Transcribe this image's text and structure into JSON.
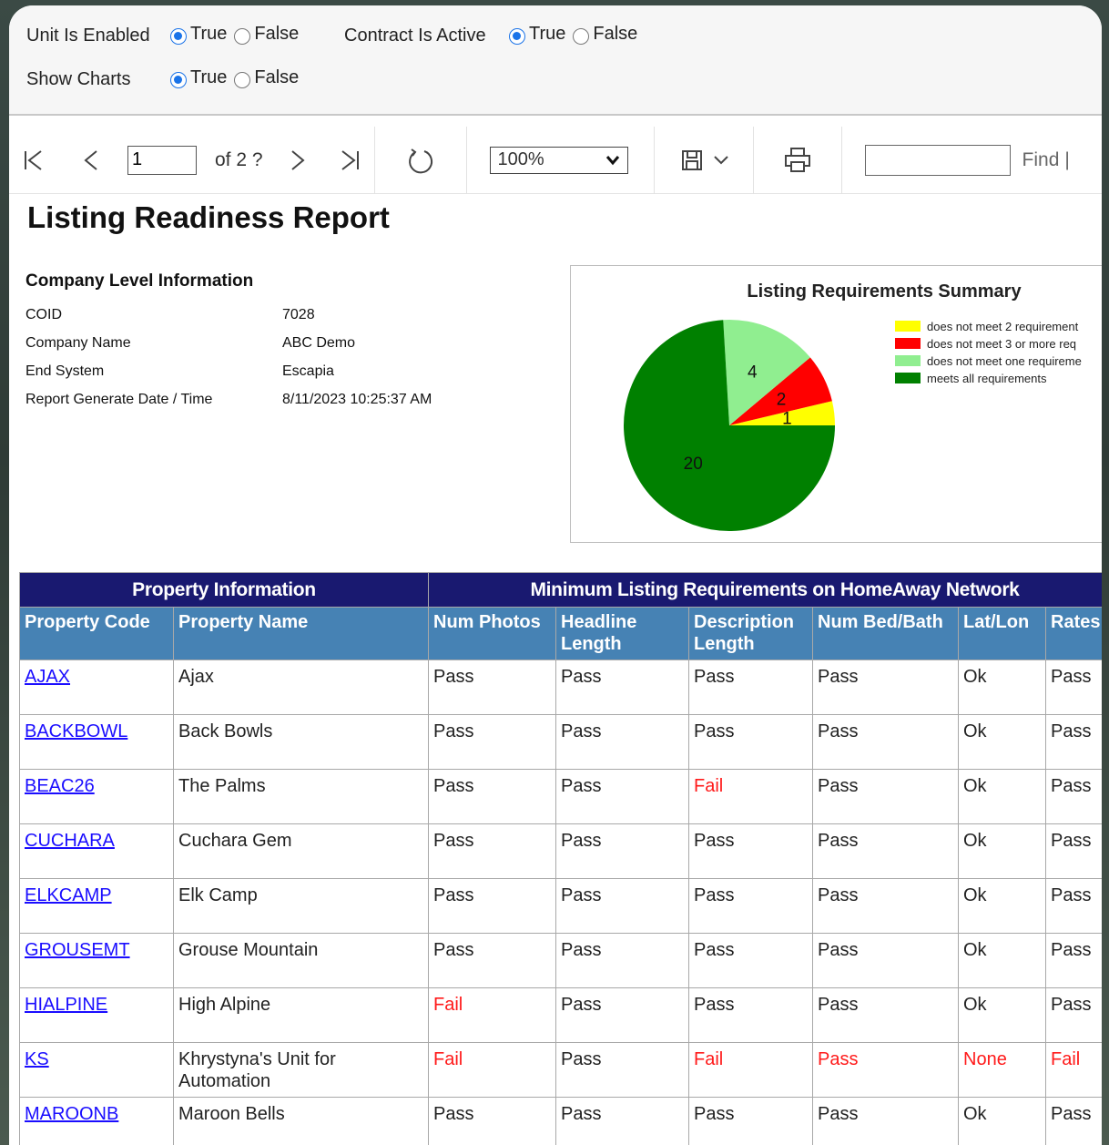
{
  "params": {
    "unit_enabled_label": "Unit Is Enabled",
    "contract_active_label": "Contract Is Active",
    "show_charts_label": "Show Charts",
    "true_label": "True",
    "false_label": "False"
  },
  "toolbar": {
    "page_value": "1",
    "page_of": "of 2 ?",
    "zoom_value": "100%",
    "find_label": "Find",
    "find_sep": "|"
  },
  "report": {
    "title": "Listing Readiness Report",
    "company_heading": "Company Level Information",
    "info": [
      {
        "key": "COID",
        "value": "7028"
      },
      {
        "key": "Company Name",
        "value": "ABC Demo"
      },
      {
        "key": "End System",
        "value": "Escapia"
      },
      {
        "key": "Report Generate Date / Time",
        "value": "8/11/2023 10:25:37 AM"
      }
    ]
  },
  "chart_data": {
    "type": "pie",
    "title": "Listing Requirements Summary",
    "slices": [
      {
        "label": "does not meet 2 requirement",
        "value": 1,
        "color": "#ffff00"
      },
      {
        "label": "does not meet 3 or more req",
        "value": 2,
        "color": "#ff0000"
      },
      {
        "label": "does not meet one requireme",
        "value": 4,
        "color": "#90ee90"
      },
      {
        "label": "meets all requirements",
        "value": 20,
        "color": "#008000"
      }
    ]
  },
  "table": {
    "group_property": "Property Information",
    "group_min": "Minimum Listing Requirements on HomeAway Network",
    "headers": [
      "Property Code",
      "Property Name",
      "Num Photos",
      "Headline Length",
      "Description Length",
      "Num Bed/Bath",
      "Lat/Lon",
      "Rates"
    ],
    "rows": [
      [
        "AJAX",
        "Ajax",
        "Pass",
        "Pass",
        "Pass",
        "Pass",
        "Ok",
        "Pass"
      ],
      [
        "BACKBOWL",
        "Back Bowls",
        "Pass",
        "Pass",
        "Pass",
        "Pass",
        "Ok",
        "Pass"
      ],
      [
        "BEAC26",
        "The Palms",
        "Pass",
        "Pass",
        "Fail",
        "Pass",
        "Ok",
        "Pass"
      ],
      [
        "CUCHARA",
        "Cuchara Gem",
        "Pass",
        "Pass",
        "Pass",
        "Pass",
        "Ok",
        "Pass"
      ],
      [
        "ELKCAMP",
        "Elk Camp",
        "Pass",
        "Pass",
        "Pass",
        "Pass",
        "Ok",
        "Pass"
      ],
      [
        "GROUSEMT",
        "Grouse Mountain",
        "Pass",
        "Pass",
        "Pass",
        "Pass",
        "Ok",
        "Pass"
      ],
      [
        "HIALPINE",
        "High Alpine",
        "Fail",
        "Pass",
        "Pass",
        "Pass",
        "Ok",
        "Pass"
      ],
      [
        "KS",
        "Khrystyna's Unit for Automation",
        "Fail",
        "Pass",
        "Fail",
        "Pass",
        "None",
        "Fail"
      ],
      [
        "MAROONB",
        "Maroon Bells",
        "Pass",
        "Pass",
        "Pass",
        "Pass",
        "Ok",
        "Pass"
      ]
    ],
    "red_cells": [
      [
        2,
        4
      ],
      [
        6,
        2
      ],
      [
        7,
        2
      ],
      [
        7,
        4
      ],
      [
        7,
        5
      ],
      [
        7,
        6
      ],
      [
        7,
        7
      ]
    ],
    "colors": {
      "group_bg": "#191970",
      "header_bg": "#4682b4",
      "link": "#1a0dff",
      "fail": "#ff1a1a"
    }
  }
}
